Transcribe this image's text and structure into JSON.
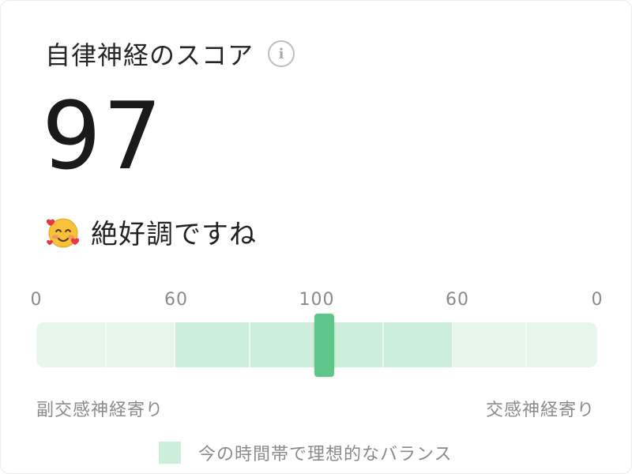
{
  "header": {
    "title": "自律神経のスコア",
    "info_icon": "info-icon"
  },
  "score": {
    "value": "97"
  },
  "status": {
    "emoji_icon": "smiling-face-with-hearts-icon",
    "text": "絶好調ですね"
  },
  "gauge": {
    "ticks": [
      "0",
      "60",
      "100",
      "60",
      "0"
    ],
    "marker_value": 97,
    "marker_side": "parasympathetic",
    "left_label": "副交感神経寄り",
    "right_label": "交感神経寄り",
    "colors": {
      "track_light": "#e6f6ea",
      "ideal_zone": "#cdeedb",
      "marker": "#5fc68a"
    }
  },
  "legend": {
    "text": "今の時間帯で理想的なバランス",
    "swatch_color": "#cdeedb"
  }
}
